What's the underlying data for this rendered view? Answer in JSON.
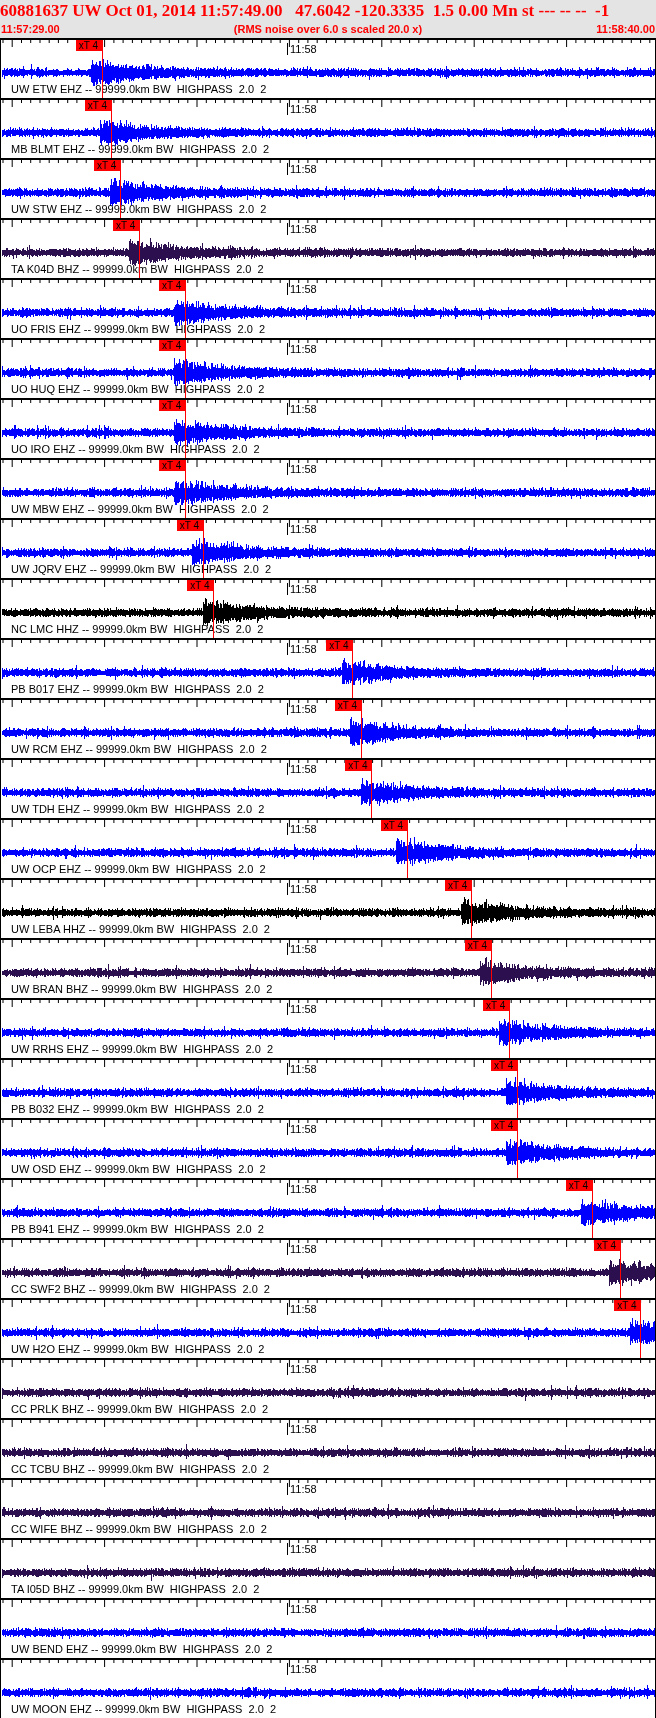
{
  "header": {
    "title": "60881637 UW Oct 01, 2014 11:57:49.00   47.6042 -120.3335  1.5 0.00 Mn st --- -- --  -1",
    "start_time": "11:57:29.00",
    "note": "(RMS noise over 6.0 s scaled 20.0 x)",
    "end_time": "11:58:40.00"
  },
  "traces": [
    {
      "label": "UW ETW EHZ -- 99999.0km BW  HIGHPASS  2.0  2",
      "color": "#0000ff",
      "time_mark": "11:58",
      "pick": {
        "label": "xT 4",
        "level": 0.155
      }
    },
    {
      "label": "MB BLMT EHZ -- 99999.0km BW  HIGHPASS  2.0  2",
      "color": "#0000ff",
      "time_mark": "11:58",
      "pick": {
        "label": "xT 4",
        "level": 0.169
      }
    },
    {
      "label": "UW STW EHZ -- 99999.0km BW  HIGHPASS  2.0  2",
      "color": "#0000ff",
      "time_mark": "11:58",
      "pick": {
        "label": "xT 4",
        "level": 0.183
      }
    },
    {
      "label": "TA K04D BHZ -- 99999.0km BW  HIGHPASS  2.0  2",
      "color": "#2b0f4f",
      "time_mark": "11:58",
      "pick": {
        "label": "xT 4",
        "level": 0.212
      }
    },
    {
      "label": "UO FRIS EHZ -- 99999.0km BW  HIGHPASS  2.0  2",
      "color": "#0000ff",
      "time_mark": "11:58",
      "pick": {
        "label": "xT 4",
        "level": 0.282
      }
    },
    {
      "label": "UO HUQ EHZ -- 99999.0km BW  HIGHPASS  2.0  2",
      "color": "#0000ff",
      "time_mark": "11:58",
      "pick": {
        "label": "xT 4",
        "level": 0.282
      }
    },
    {
      "label": "UO IRO EHZ -- 99999.0km BW  HIGHPASS  2.0  2",
      "color": "#0000ff",
      "time_mark": "11:58",
      "pick": {
        "label": "xT 4",
        "level": 0.282
      }
    },
    {
      "label": "UW MBW EHZ -- 99999.0km BW  HIGHPASS  2.0  2",
      "color": "#0000ff",
      "time_mark": "11:58",
      "pick": {
        "label": "xT 4",
        "level": 0.282
      }
    },
    {
      "label": "UW JQRV EHZ -- 99999.0km BW  HIGHPASS  2.0  2",
      "color": "#0000ff",
      "time_mark": "11:58",
      "pick": {
        "label": "xT 4",
        "level": 0.309
      }
    },
    {
      "label": "NC LMC HHZ -- 99999.0km BW  HIGHPASS  2.0  2",
      "color": "#000000",
      "time_mark": "11:58",
      "pick": {
        "label": "xT 4",
        "level": 0.325
      }
    },
    {
      "label": "PB B017 EHZ -- 99999.0km BW  HIGHPASS  2.0  2",
      "color": "#0000ff",
      "time_mark": "11:58",
      "pick": {
        "label": "xT 4",
        "level": 0.537
      }
    },
    {
      "label": "UW RCM EHZ -- 99999.0km BW  HIGHPASS  2.0  2",
      "color": "#0000ff",
      "time_mark": "11:58",
      "pick": {
        "label": "xT 4",
        "level": 0.55
      }
    },
    {
      "label": "UW TDH EHZ -- 99999.0km BW  HIGHPASS  2.0  2",
      "color": "#0000ff",
      "time_mark": "11:58",
      "pick": {
        "label": "xT 4",
        "level": 0.566
      }
    },
    {
      "label": "UW OCP EHZ -- 99999.0km BW  HIGHPASS  2.0  2",
      "color": "#0000ff",
      "time_mark": "11:58",
      "pick": {
        "label": "xT 4",
        "level": 0.62
      }
    },
    {
      "label": "UW LEBA HHZ -- 99999.0km BW  HIGHPASS  2.0  2",
      "color": "#000000",
      "time_mark": "11:58",
      "pick": {
        "label": "xT 4",
        "level": 0.718
      }
    },
    {
      "label": "UW BRAN BHZ -- 99999.0km BW  HIGHPASS  2.0  2",
      "color": "#2b0f4f",
      "time_mark": "11:58",
      "pick": {
        "label": "xT 4",
        "level": 0.748
      }
    },
    {
      "label": "UW RRHS EHZ -- 99999.0km BW  HIGHPASS  2.0  2",
      "color": "#0000ff",
      "time_mark": "11:58",
      "pick": {
        "label": "xT 4",
        "level": 0.776
      }
    },
    {
      "label": "PB B032 EHZ -- 99999.0km BW  HIGHPASS  2.0  2",
      "color": "#0000ff",
      "time_mark": "11:58",
      "pick": {
        "label": "xT 4",
        "level": 0.788
      }
    },
    {
      "label": "UW OSD EHZ -- 99999.0km BW  HIGHPASS  2.0  2",
      "color": "#0000ff",
      "time_mark": "11:58",
      "pick": {
        "label": "xT 4",
        "level": 0.788
      }
    },
    {
      "label": "PB B941 EHZ -- 99999.0km BW  HIGHPASS  2.0  2",
      "color": "#0000ff",
      "time_mark": "11:58",
      "pick": {
        "label": "xT 4",
        "level": 0.902
      }
    },
    {
      "label": "CC SWF2 BHZ -- 99999.0km BW  HIGHPASS  2.0  2",
      "color": "#2b0f4f",
      "time_mark": "11:58",
      "pick": {
        "label": "xT 4",
        "level": 0.945
      }
    },
    {
      "label": "UW H2O EHZ -- 99999.0km BW  HIGHPASS  2.0  2",
      "color": "#0000ff",
      "time_mark": "11:58",
      "pick": {
        "label": "xT 4",
        "level": 0.976
      }
    },
    {
      "label": "CC PRLK BHZ -- 99999.0km BW  HIGHPASS  2.0  2",
      "color": "#2b0f4f",
      "time_mark": "11:58"
    },
    {
      "label": "CC TCBU BHZ -- 99999.0km BW  HIGHPASS  2.0  2",
      "color": "#2b0f4f",
      "time_mark": "11:58"
    },
    {
      "label": "CC WIFE BHZ -- 99999.0km BW  HIGHPASS  2.0  2",
      "color": "#2b0f4f",
      "time_mark": "11:58"
    },
    {
      "label": "TA I05D BHZ -- 99999.0km BW  HIGHPASS  2.0  2",
      "color": "#2b0f4f",
      "time_mark": "11:58"
    },
    {
      "label": "UW BEND EHZ -- 99999.0km BW  HIGHPASS  2.0  2",
      "color": "#0000ff",
      "time_mark": "11:58"
    },
    {
      "label": "UW MOON EHZ -- 99999.0km BW  HIGHPASS  2.0  2",
      "color": "#0000ff",
      "time_mark": "11:58"
    }
  ]
}
